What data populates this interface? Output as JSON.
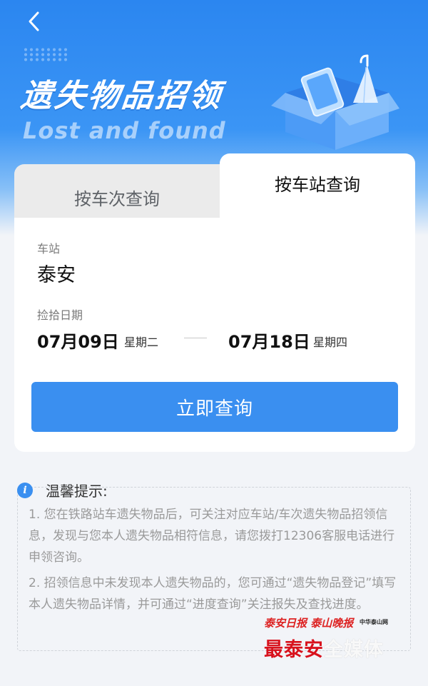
{
  "header": {
    "title": "遗失物品招领",
    "subtitle": "Lost and found"
  },
  "tabs": [
    {
      "label": "按车次查询",
      "active": false
    },
    {
      "label": "按车站查询",
      "active": true
    }
  ],
  "form": {
    "station_label": "车站",
    "station_value": "泰安",
    "date_label": "捡拾日期",
    "start_date": "07月09日",
    "start_weekday": "星期二",
    "end_date": "07月18日",
    "end_weekday": "星期四",
    "query_button": "立即查询"
  },
  "tips": {
    "title": "温馨提示:",
    "items": [
      "1. 您在铁路站车遗失物品后，可关注对应车站/车次遗失物品招领信息，发现与您本人遗失物品相符信息，请您拨打12306客服电话进行申领咨询。",
      "2. 招领信息中未发现本人遗失物品的，您可通过“遗失物品登记”填写本人遗失物品详情，并可通过“进度查询”关注报失及查找进度。"
    ]
  },
  "watermark": {
    "top": "泰安日报 泰山晚报",
    "brand_small": "中华泰山网",
    "main_a": "最泰安",
    "main_b": "全媒体"
  },
  "colors": {
    "primary": "#3a8ff0",
    "hero_blue": "#2b86f0",
    "brand_red": "#d8121d"
  }
}
